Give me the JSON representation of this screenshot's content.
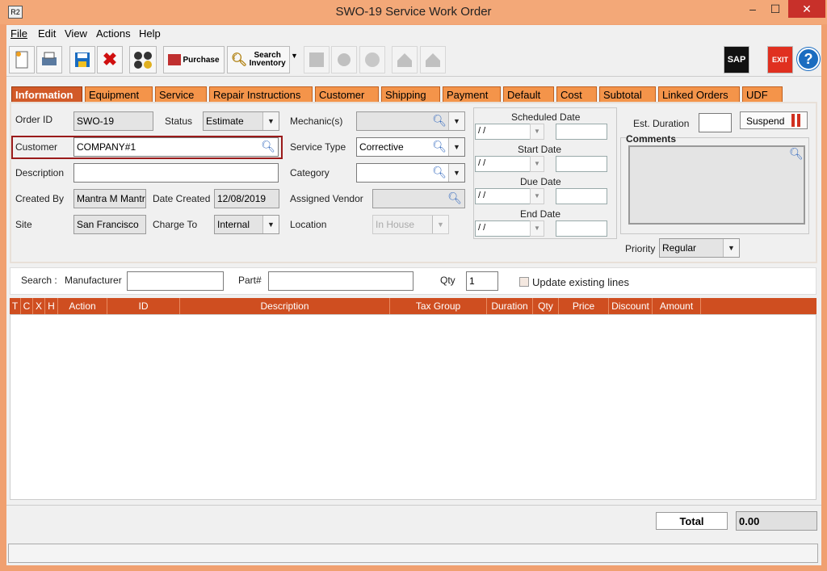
{
  "window": {
    "app_icon": "R2",
    "title": "SWO-19 Service Work Order",
    "minimize": "–",
    "maximize": "☐",
    "close": "✕"
  },
  "menu": [
    "File",
    "Edit",
    "View",
    "Actions",
    "Help"
  ],
  "toolbar": {
    "purchase_label": "Purchase",
    "search_inventory_label": "Search Inventory",
    "sap_label": "SAP",
    "exit_label": "EXIT",
    "help_label": "?"
  },
  "tabs": [
    "Information",
    "Equipment",
    "Service",
    "Repair Instructions",
    "Customer",
    "Shipping",
    "Payment",
    "Default",
    "Cost",
    "Subtotal",
    "Linked Orders",
    "UDF"
  ],
  "form": {
    "order_id_label": "Order ID",
    "order_id": "SWO-19",
    "status_label": "Status",
    "status": "Estimate",
    "mechanics_label": "Mechanic(s)",
    "mechanics": "",
    "customer_label": "Customer",
    "customer": "COMPANY#1",
    "service_type_label": "Service Type",
    "service_type": "Corrective",
    "description_label": "Description",
    "description": "",
    "category_label": "Category",
    "category": "",
    "created_by_label": "Created By",
    "created_by": "Mantra M Mantra",
    "date_created_label": "Date Created",
    "date_created": "12/08/2019",
    "assigned_vendor_label": "Assigned Vendor",
    "assigned_vendor": "",
    "site_label": "Site",
    "site": "San Francisco",
    "charge_to_label": "Charge To",
    "charge_to": "Internal",
    "location_label": "Location",
    "location": "In House"
  },
  "dates": {
    "scheduled_label": "Scheduled Date",
    "scheduled": "/ /",
    "start_label": "Start Date",
    "start": "/ /",
    "due_label": "Due Date",
    "due": "/ /",
    "end_label": "End Date",
    "end": "/ /"
  },
  "right": {
    "est_duration_label": "Est. Duration",
    "est_duration": "",
    "suspend_label": "Suspend",
    "comments_label": "Comments",
    "comments": "",
    "priority_label": "Priority",
    "priority": "Regular"
  },
  "search": {
    "search_label": "Search :",
    "manufacturer_label": "Manufacturer",
    "manufacturer": "",
    "part_label": "Part#",
    "part": "",
    "qty_label": "Qty",
    "qty": "1",
    "update_label": "Update existing lines"
  },
  "grid_columns": [
    "T",
    "C",
    "X",
    "H",
    "Action",
    "ID",
    "Description",
    "Tax Group",
    "Duration",
    "Qty",
    "Price",
    "Discount",
    "Amount"
  ],
  "footer": {
    "total_label": "Total",
    "total_value": "0.00"
  },
  "colors": {
    "accent": "#d25a28",
    "tab": "#f4944a",
    "grid_header": "#cf4e20",
    "window_frame": "#f0a070"
  }
}
